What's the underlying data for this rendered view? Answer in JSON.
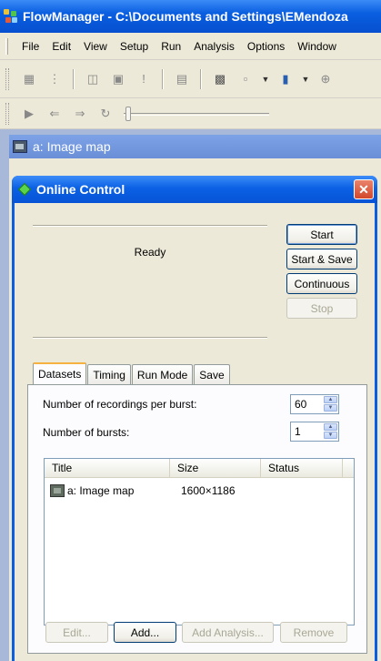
{
  "app": {
    "title": "FlowManager - C:\\Documents and Settings\\EMendoza"
  },
  "menu": [
    "File",
    "Edit",
    "View",
    "Setup",
    "Run",
    "Analysis",
    "Options",
    "Window"
  ],
  "child_window": {
    "title": "a: Image map"
  },
  "dialog": {
    "title": "Online Control",
    "status": "Ready",
    "buttons": {
      "start": "Start",
      "start_save": "Start & Save",
      "continuous": "Continuous",
      "stop": "Stop"
    },
    "tabs": [
      "Datasets",
      "Timing",
      "Run Mode",
      "Save"
    ],
    "active_tab": "Datasets",
    "fields": {
      "recordings_label": "Number of recordings per burst:",
      "recordings_value": "60",
      "bursts_label": "Number of bursts:",
      "bursts_value": "1"
    },
    "list": {
      "columns": [
        "Title",
        "Size",
        "Status"
      ],
      "rows": [
        {
          "title": "a: Image map",
          "size": "1600×1186",
          "status": ""
        }
      ]
    },
    "bottom_buttons": {
      "edit": "Edit...",
      "add": "Add...",
      "add_analysis": "Add Analysis...",
      "remove": "Remove"
    }
  }
}
